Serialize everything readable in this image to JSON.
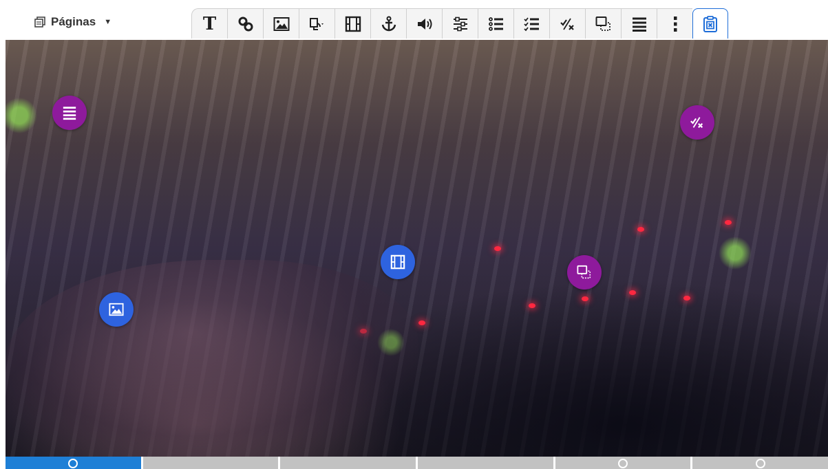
{
  "header": {
    "pages_label": "Páginas"
  },
  "toolbar": {
    "tools": [
      {
        "name": "text-tool",
        "icon": "text-icon",
        "glyph": "T"
      },
      {
        "name": "link-tool",
        "icon": "link-icon"
      },
      {
        "name": "image-tool",
        "icon": "image-icon"
      },
      {
        "name": "shape-tool",
        "icon": "shape-dropdown-icon"
      },
      {
        "name": "video-tool",
        "icon": "film-icon"
      },
      {
        "name": "anchor-tool",
        "icon": "anchor-icon"
      },
      {
        "name": "audio-tool",
        "icon": "speaker-icon"
      },
      {
        "name": "sliders-tool",
        "icon": "sliders-icon"
      },
      {
        "name": "list-tool",
        "icon": "bullet-list-icon"
      },
      {
        "name": "checklist-tool",
        "icon": "checklist-icon"
      },
      {
        "name": "true-false-tool",
        "icon": "check-cross-icon"
      },
      {
        "name": "drag-drop-tool",
        "icon": "drag-drop-icon"
      },
      {
        "name": "menu-tool",
        "icon": "list-lines-icon"
      },
      {
        "name": "more-tool",
        "icon": "vertical-dots-icon"
      },
      {
        "name": "clipboard-cancel-tool",
        "icon": "clipboard-x-icon",
        "active": true
      }
    ]
  },
  "hotspots": [
    {
      "name": "hotspot-list",
      "icon": "list-lines-icon",
      "color": "purple"
    },
    {
      "name": "hotspot-check-cross",
      "icon": "check-cross-icon",
      "color": "purple"
    },
    {
      "name": "hotspot-film",
      "icon": "film-icon",
      "color": "blue"
    },
    {
      "name": "hotspot-drag-drop",
      "icon": "drag-drop-icon",
      "color": "purple"
    },
    {
      "name": "hotspot-image",
      "icon": "image-icon",
      "color": "blue"
    }
  ],
  "page_tabs": [
    {
      "name": "page-tab-1",
      "active": true,
      "marker": true
    },
    {
      "name": "page-tab-2",
      "active": false,
      "marker": false
    },
    {
      "name": "page-tab-3",
      "active": false,
      "marker": false
    },
    {
      "name": "page-tab-4",
      "active": false,
      "marker": false
    },
    {
      "name": "page-tab-5",
      "active": false,
      "marker": true
    },
    {
      "name": "page-tab-6",
      "active": false,
      "marker": true
    }
  ],
  "colors": {
    "accent": "#1e7fd6",
    "hotspot_purple": "#8e1a9c",
    "hotspot_blue": "#2e63df",
    "tab_inactive": "#c2c2c2"
  }
}
